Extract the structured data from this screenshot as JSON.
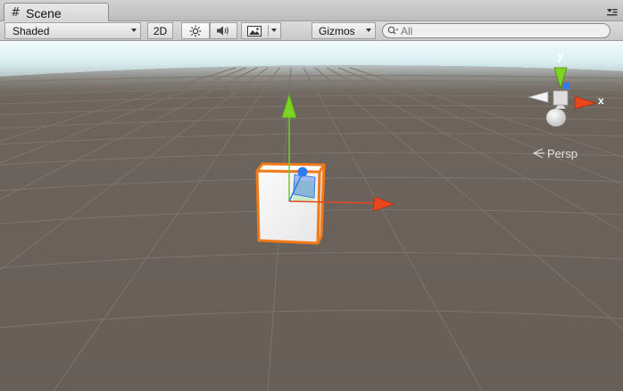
{
  "window": {
    "tab_label": "Scene",
    "tab_icon": "hash-grid-icon",
    "tab_menu_icon": "panel-menu-icon"
  },
  "toolbar": {
    "draw_mode": "Shaded",
    "mode_2d_label": "2D",
    "lighting_icon": "sun-icon",
    "audio_icon": "speaker-icon",
    "effects_icon": "image-icon",
    "gizmos_label": "Gizmos",
    "search_placeholder": "All"
  },
  "gizmo": {
    "axis_y": "y",
    "axis_x": "x",
    "projection_label": "Persp",
    "colors": {
      "x": "#e8461c",
      "y": "#7dd321",
      "z": "#2d7bf0"
    }
  },
  "scene": {
    "sky_color": "#e4f4f6",
    "ground_color": "#6b625b",
    "selection_outline_color": "#f07a17",
    "cube_color": "#f4f4f4"
  }
}
